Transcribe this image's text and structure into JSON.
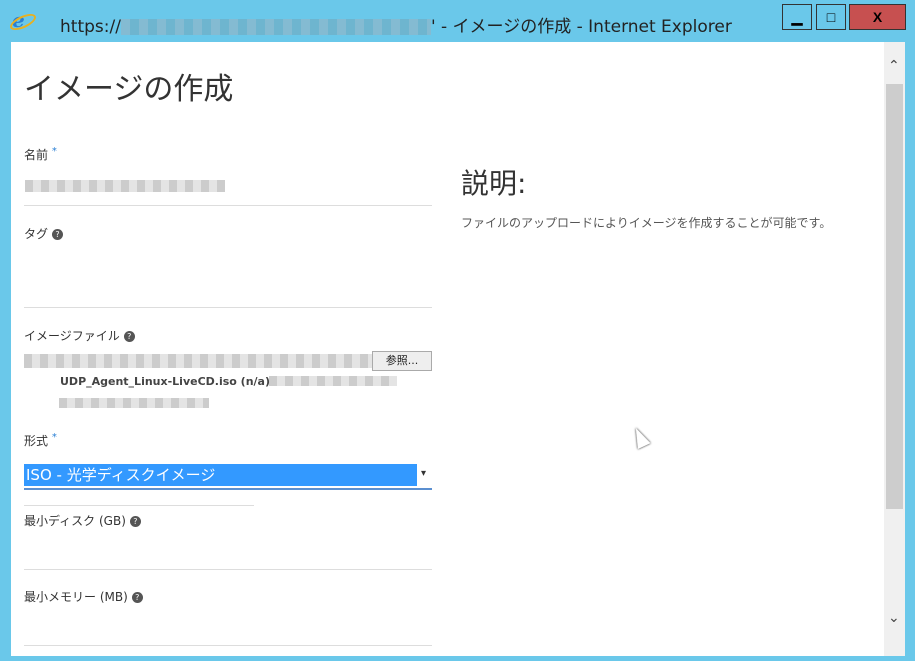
{
  "window": {
    "title_prefix": "https://",
    "title_suffix": "' - イメージの作成 - Internet Explorer",
    "minimize": "▁",
    "maximize": "□",
    "close": "X"
  },
  "form": {
    "heading": "イメージの作成",
    "name_label": "名前",
    "required_mark": "*",
    "tag_label": "タグ",
    "help": "?",
    "image_file_label": "イメージファイル",
    "browse_button": "参照...",
    "file_name": "UDP_Agent_Linux-LiveCD.iso (n/a)",
    "format_label": "形式",
    "format_value": "ISO - 光学ディスクイメージ",
    "dropdown_arrow": "▾",
    "min_disk_label": "最小ディスク (GB)",
    "min_memory_label": "最小メモリー (MB)"
  },
  "description": {
    "heading": "説明:",
    "text": "ファイルのアップロードによりイメージを作成することが可能です。"
  },
  "scrollbar": {
    "up": "⌃",
    "down": "⌄"
  }
}
